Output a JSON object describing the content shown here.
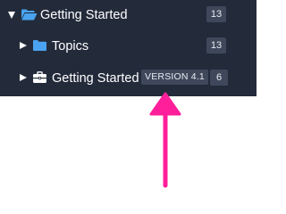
{
  "tree": {
    "items": [
      {
        "label": "Getting Started",
        "count": "13",
        "icon": "open-folder-icon",
        "expander": "expanded"
      },
      {
        "label": "Topics",
        "count": "13",
        "icon": "folder-icon",
        "expander": "collapsed"
      },
      {
        "label": "Getting Started",
        "count": "6",
        "version": "VERSION 4.1",
        "icon": "briefcase-icon",
        "expander": "collapsed"
      }
    ]
  },
  "colors": {
    "panel_background": "#232b3b",
    "badge_background": "#3f485b",
    "folder_blue": "#4aa3f0",
    "annotation_arrow": "#ff1f9a"
  }
}
